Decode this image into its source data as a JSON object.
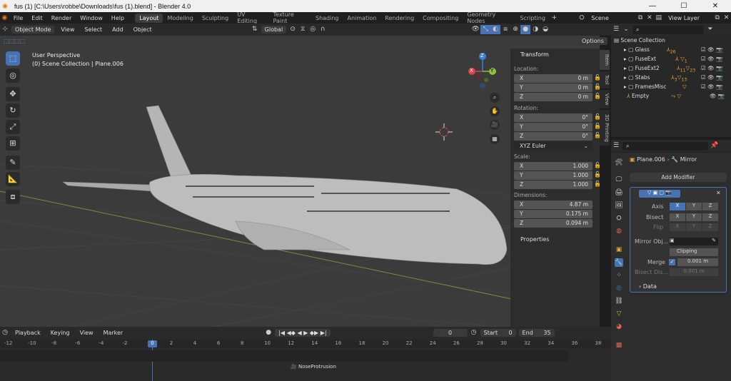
{
  "window": {
    "title": "fus (1) [C:\\Users\\robbe\\Downloads\\fus (1).blend] - Blender 4.0"
  },
  "menu": {
    "items": [
      "File",
      "Edit",
      "Render",
      "Window",
      "Help"
    ],
    "workspaces": [
      "Layout",
      "Modeling",
      "Sculpting",
      "UV Editing",
      "Texture Paint",
      "Shading",
      "Animation",
      "Rendering",
      "Compositing",
      "Geometry Nodes",
      "Scripting"
    ],
    "scene": "Scene",
    "view_layer": "View Layer"
  },
  "viewport_header": {
    "mode": "Object Mode",
    "menus": [
      "View",
      "Select",
      "Add",
      "Object"
    ],
    "orientation": "Global",
    "options": "Options"
  },
  "viewport": {
    "perspective": "User Perspective",
    "collection": "(0) Scene Collection | Plane.006",
    "gizmo": {
      "x": "X",
      "y": "Y",
      "z": "Z"
    }
  },
  "npanel": {
    "tabs": [
      "Item",
      "Tool",
      "View",
      "3D Printing"
    ],
    "transform": "Transform",
    "location_label": "Location:",
    "location": [
      {
        "k": "X",
        "v": "0 m"
      },
      {
        "k": "Y",
        "v": "0 m"
      },
      {
        "k": "Z",
        "v": "0 m"
      }
    ],
    "rotation_label": "Rotation:",
    "rotation": [
      {
        "k": "X",
        "v": "0°"
      },
      {
        "k": "Y",
        "v": "0°"
      },
      {
        "k": "Z",
        "v": "0°"
      }
    ],
    "euler": "XYZ Euler",
    "scale_label": "Scale:",
    "scale": [
      {
        "k": "X",
        "v": "1.000"
      },
      {
        "k": "Y",
        "v": "1.000"
      },
      {
        "k": "Z",
        "v": "1.000"
      }
    ],
    "dimensions_label": "Dimensions:",
    "dimensions": [
      {
        "k": "X",
        "v": "4.87 m"
      },
      {
        "k": "Y",
        "v": "0.175 m"
      },
      {
        "k": "Z",
        "v": "0.094 m"
      }
    ],
    "properties": "Properties"
  },
  "outliner": {
    "root": "Scene Collection",
    "items": [
      {
        "name": "Glass",
        "n1": "26"
      },
      {
        "name": "FuseExt",
        "n1": "1"
      },
      {
        "name": "FuseExt2",
        "n1": "11",
        "n2": "23"
      },
      {
        "name": "Stabs",
        "n1": "3",
        "n2": "13"
      },
      {
        "name": "FramesMisc"
      },
      {
        "name": "Empty"
      }
    ]
  },
  "properties": {
    "object": "Plane.006",
    "modifier": "Mirror",
    "add_modifier": "Add Modifier",
    "axis": "Axis",
    "bisect": "Bisect",
    "flip": "Flip",
    "xyz": [
      "X",
      "Y",
      "Z"
    ],
    "mirror_object": "Mirror Obj...",
    "clipping": "Clipping",
    "merge": "Merge",
    "merge_val": "0.001 m",
    "bisect_dist": "Bisect Dis...",
    "bisect_val": "0.001 m",
    "data": "Data"
  },
  "timeline": {
    "menus": [
      "Playback",
      "Keying",
      "View",
      "Marker"
    ],
    "current": "0",
    "start_label": "Start",
    "start": "0",
    "end_label": "End",
    "end": "35",
    "ruler": [
      "-12",
      "-10",
      "-8",
      "-6",
      "-4",
      "-2",
      "0",
      "2",
      "4",
      "6",
      "8",
      "10",
      "12",
      "14",
      "16",
      "18",
      "20",
      "22",
      "24",
      "26",
      "28",
      "30",
      "32",
      "34",
      "36",
      "38"
    ],
    "marker": "NoseProtrusion"
  },
  "colors": {
    "accent": "#4772b3",
    "orange": "#e8a33a",
    "x": "#e04050",
    "y": "#8ac23b",
    "z": "#3b7ee0"
  }
}
